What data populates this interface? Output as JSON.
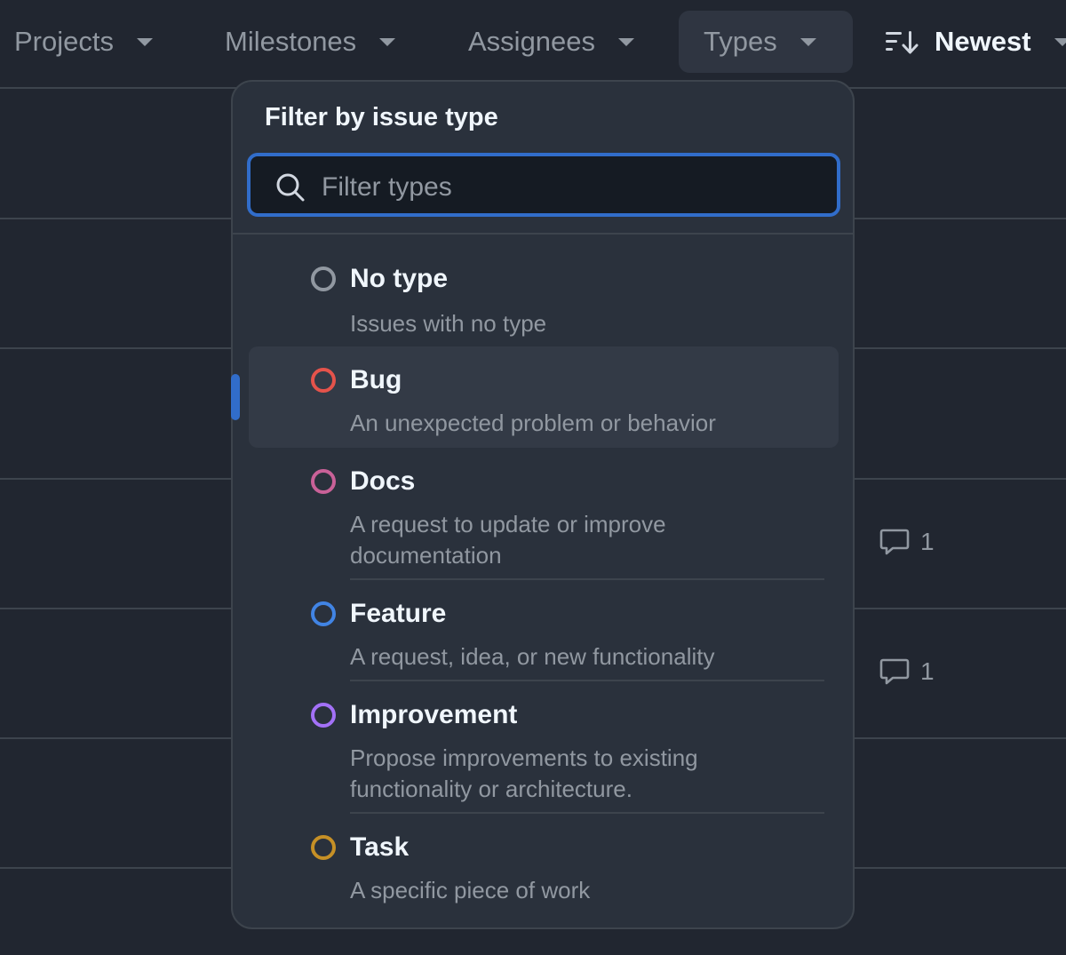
{
  "filters": {
    "projects": "Projects",
    "milestones": "Milestones",
    "assignees": "Assignees",
    "types": "Types",
    "sort": "Newest"
  },
  "background": {
    "comment_counts": [
      "1",
      "1"
    ]
  },
  "dropdown": {
    "title": "Filter by issue type",
    "search_placeholder": "Filter types",
    "search_value": "",
    "options": [
      {
        "name": "No type",
        "description": "Issues with no type",
        "color": "#9198a1"
      },
      {
        "name": "Bug",
        "description": "An unexpected problem or behavior",
        "color": "#e5534b"
      },
      {
        "name": "Docs",
        "description": "A request to update or improve documentation",
        "color": "#c96198"
      },
      {
        "name": "Feature",
        "description": "A request, idea, or new functionality",
        "color": "#4184e4"
      },
      {
        "name": "Improvement",
        "description": "Propose improvements to existing functionality or architecture.",
        "color": "#a371f7"
      },
      {
        "name": "Task",
        "description": "A specific piece of work",
        "color": "#c69026"
      }
    ],
    "highlighted": "Bug"
  },
  "colors": {
    "accent": "#316dca",
    "background": "#212630",
    "panel": "#2a313c"
  }
}
